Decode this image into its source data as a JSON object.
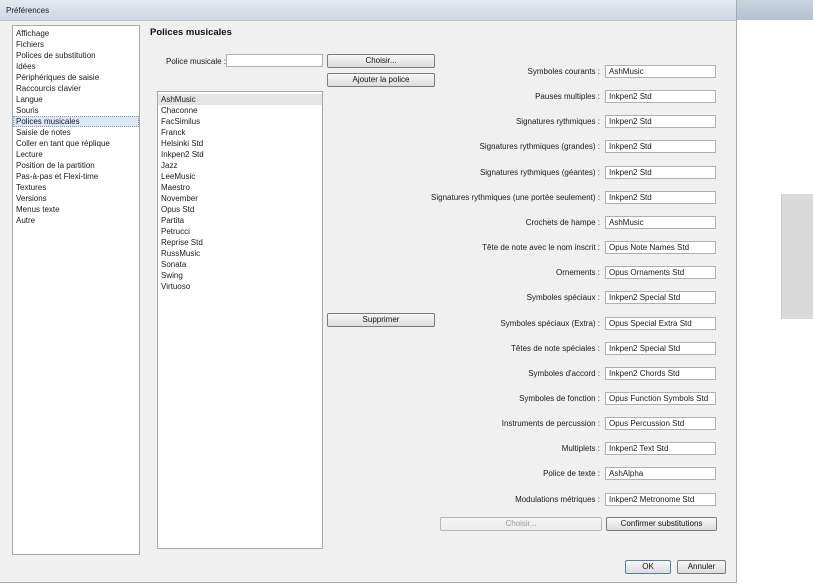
{
  "window": {
    "title": "Préférences"
  },
  "categories": [
    {
      "label": "Affichage",
      "selected": false
    },
    {
      "label": "Fichiers",
      "selected": false
    },
    {
      "label": "Polices de substitution",
      "selected": false
    },
    {
      "label": "Idées",
      "selected": false
    },
    {
      "label": "Périphériques de saisie",
      "selected": false
    },
    {
      "label": "Raccourcis clavier",
      "selected": false
    },
    {
      "label": "Langue",
      "selected": false
    },
    {
      "label": "Souris",
      "selected": false
    },
    {
      "label": "Polices musicales",
      "selected": true
    },
    {
      "label": "Saisie de notes",
      "selected": false
    },
    {
      "label": "Coller en tant que réplique",
      "selected": false
    },
    {
      "label": "Lecture",
      "selected": false
    },
    {
      "label": "Position de la partition",
      "selected": false
    },
    {
      "label": "Pas-à-pas et Flexi-time",
      "selected": false
    },
    {
      "label": "Textures",
      "selected": false
    },
    {
      "label": "Versions",
      "selected": false
    },
    {
      "label": "Menus texte",
      "selected": false
    },
    {
      "label": "Autre",
      "selected": false
    }
  ],
  "panel": {
    "title": "Polices musicales",
    "font_label": "Police musicale :",
    "font_value": "",
    "choose_button": "Choisir...",
    "add_font_button": "Ajouter la police",
    "delete_button": "Supprimer",
    "fonts": [
      {
        "label": "AshMusic",
        "selected": true
      },
      {
        "label": "Chaconne",
        "selected": false
      },
      {
        "label": "FacSimilus",
        "selected": false
      },
      {
        "label": "Franck",
        "selected": false
      },
      {
        "label": "Helsinki Std",
        "selected": false
      },
      {
        "label": "Inkpen2 Std",
        "selected": false
      },
      {
        "label": "Jazz",
        "selected": false
      },
      {
        "label": "LeeMusic",
        "selected": false
      },
      {
        "label": "Maestro",
        "selected": false
      },
      {
        "label": "November",
        "selected": false
      },
      {
        "label": "Opus Std",
        "selected": false
      },
      {
        "label": "Partita",
        "selected": false
      },
      {
        "label": "Petrucci",
        "selected": false
      },
      {
        "label": "Reprise Std",
        "selected": false
      },
      {
        "label": "RussMusic",
        "selected": false
      },
      {
        "label": "Sonata",
        "selected": false
      },
      {
        "label": "Swing",
        "selected": false
      },
      {
        "label": "Virtuoso",
        "selected": false
      }
    ],
    "mappings": [
      {
        "label": "Symboles courants :",
        "value": "AshMusic"
      },
      {
        "label": "Pauses multiples :",
        "value": "Inkpen2 Std"
      },
      {
        "label": "Signatures rythmiques :",
        "value": "Inkpen2 Std"
      },
      {
        "label": "Signatures rythmiques (grandes) :",
        "value": "Inkpen2 Std"
      },
      {
        "label": "Signatures rythmiques (géantes) :",
        "value": "Inkpen2 Std"
      },
      {
        "label": "Signatures rythmiques (une portée seulement) :",
        "value": "Inkpen2 Std"
      },
      {
        "label": "Crochets de hampe :",
        "value": "AshMusic"
      },
      {
        "label": "Tête de note avec le nom inscrit :",
        "value": "Opus Note Names Std"
      },
      {
        "label": "Ornements :",
        "value": "Opus Ornaments Std"
      },
      {
        "label": "Symboles spéciaux :",
        "value": "Inkpen2 Special Std"
      },
      {
        "label": "Symboles spéciaux (Extra) :",
        "value": "Opus Special Extra Std"
      },
      {
        "label": "Têtes de note spéciales :",
        "value": "Inkpen2 Special Std"
      },
      {
        "label": "Symboles d'accord :",
        "value": "Inkpen2 Chords Std"
      },
      {
        "label": "Symboles de fonction :",
        "value": "Opus Function Symbols Std"
      },
      {
        "label": "Instruments de percussion :",
        "value": "Opus Percussion Std"
      },
      {
        "label": "Multiplets :",
        "value": "Inkpen2 Text Std"
      },
      {
        "label": "Police de texte :",
        "value": "AshAlpha"
      },
      {
        "label": "Modulations métriques :",
        "value": "Inkpen2 Metronome Std"
      }
    ],
    "choose_disabled_button": "Choisir...",
    "confirm_button": "Confirmer substitutions"
  },
  "footer": {
    "ok": "OK",
    "cancel": "Annuler"
  }
}
